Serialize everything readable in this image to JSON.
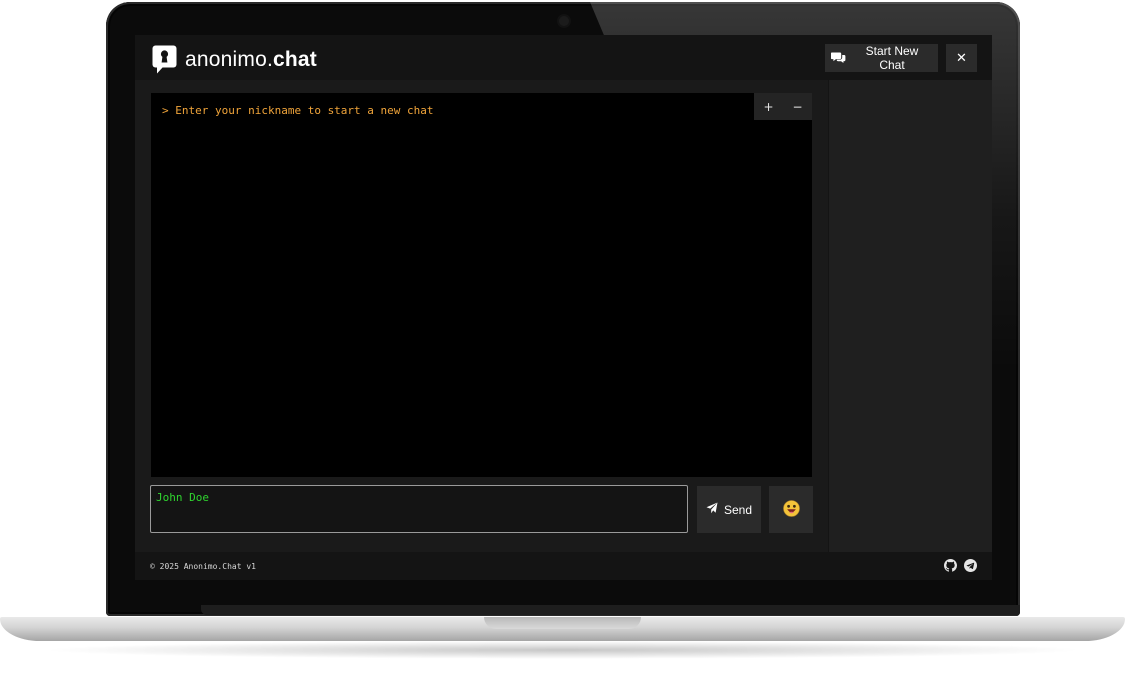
{
  "app": {
    "brand_prefix": "anonimo.",
    "brand_suffix": "chat"
  },
  "header": {
    "start_new_chat_label": "Start New Chat",
    "start_new_chat_icon": "comments-icon",
    "close_label": "✕"
  },
  "terminal": {
    "prompt_line": "> Enter your nickname to start a new chat",
    "zoom_in_label": "+",
    "zoom_out_label": "−"
  },
  "composer": {
    "input_value": "John Doe",
    "send_label": "Send",
    "send_icon": "paper-plane-icon",
    "emoji_icon": "emoji-face-icon"
  },
  "footer": {
    "copyright": "© 2025 Anonimo.Chat v1",
    "icons": [
      "github-icon",
      "telegram-icon"
    ]
  },
  "colors": {
    "prompt": "#f0a43a",
    "input_text": "#2fd52f",
    "background": "#1a1a1a",
    "terminal": "#000000"
  }
}
